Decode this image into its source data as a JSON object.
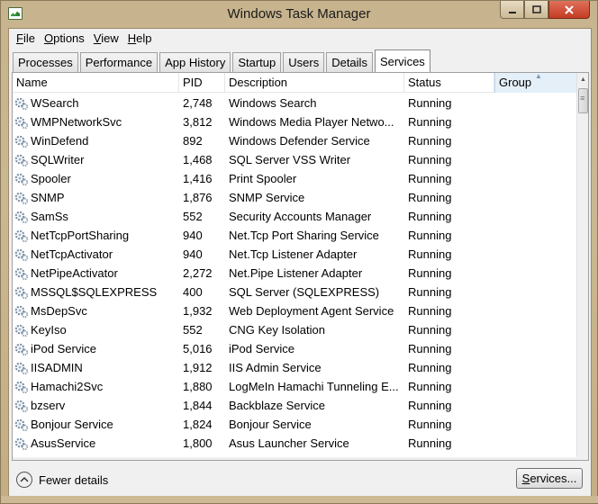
{
  "window": {
    "title": "Windows Task Manager"
  },
  "menu": [
    {
      "label": "File",
      "hotkey": "F",
      "rest": "ile"
    },
    {
      "label": "Options",
      "hotkey": "O",
      "rest": "ptions"
    },
    {
      "label": "View",
      "hotkey": "V",
      "rest": "iew"
    },
    {
      "label": "Help",
      "hotkey": "H",
      "rest": "elp"
    }
  ],
  "tabs": [
    {
      "label": "Processes"
    },
    {
      "label": "Performance"
    },
    {
      "label": "App History"
    },
    {
      "label": "Startup"
    },
    {
      "label": "Users"
    },
    {
      "label": "Details"
    },
    {
      "label": "Services",
      "active": true
    }
  ],
  "columns": {
    "name": "Name",
    "pid": "PID",
    "description": "Description",
    "status": "Status",
    "group": "Group"
  },
  "rows": [
    {
      "name": "WSearch",
      "pid": "2,748",
      "description": "Windows Search",
      "status": "Running",
      "group": ""
    },
    {
      "name": "WMPNetworkSvc",
      "pid": "3,812",
      "description": "Windows Media Player Netwo...",
      "status": "Running",
      "group": ""
    },
    {
      "name": "WinDefend",
      "pid": "892",
      "description": "Windows Defender Service",
      "status": "Running",
      "group": ""
    },
    {
      "name": "SQLWriter",
      "pid": "1,468",
      "description": "SQL Server VSS Writer",
      "status": "Running",
      "group": ""
    },
    {
      "name": "Spooler",
      "pid": "1,416",
      "description": "Print Spooler",
      "status": "Running",
      "group": ""
    },
    {
      "name": "SNMP",
      "pid": "1,876",
      "description": "SNMP Service",
      "status": "Running",
      "group": ""
    },
    {
      "name": "SamSs",
      "pid": "552",
      "description": "Security Accounts Manager",
      "status": "Running",
      "group": ""
    },
    {
      "name": "NetTcpPortSharing",
      "pid": "940",
      "description": "Net.Tcp Port Sharing Service",
      "status": "Running",
      "group": ""
    },
    {
      "name": "NetTcpActivator",
      "pid": "940",
      "description": "Net.Tcp Listener Adapter",
      "status": "Running",
      "group": ""
    },
    {
      "name": "NetPipeActivator",
      "pid": "2,272",
      "description": "Net.Pipe Listener Adapter",
      "status": "Running",
      "group": ""
    },
    {
      "name": "MSSQL$SQLEXPRESS",
      "pid": "400",
      "description": "SQL Server (SQLEXPRESS)",
      "status": "Running",
      "group": ""
    },
    {
      "name": "MsDepSvc",
      "pid": "1,932",
      "description": "Web Deployment Agent Service",
      "status": "Running",
      "group": ""
    },
    {
      "name": "KeyIso",
      "pid": "552",
      "description": "CNG Key Isolation",
      "status": "Running",
      "group": ""
    },
    {
      "name": "iPod Service",
      "pid": "5,016",
      "description": "iPod Service",
      "status": "Running",
      "group": ""
    },
    {
      "name": "IISADMIN",
      "pid": "1,912",
      "description": "IIS Admin Service",
      "status": "Running",
      "group": ""
    },
    {
      "name": "Hamachi2Svc",
      "pid": "1,880",
      "description": "LogMeIn Hamachi Tunneling E...",
      "status": "Running",
      "group": ""
    },
    {
      "name": "bzserv",
      "pid": "1,844",
      "description": "Backblaze Service",
      "status": "Running",
      "group": ""
    },
    {
      "name": "Bonjour Service",
      "pid": "1,824",
      "description": "Bonjour Service",
      "status": "Running",
      "group": ""
    },
    {
      "name": "AsusService",
      "pid": "1,800",
      "description": "Asus Launcher Service",
      "status": "Running",
      "group": ""
    }
  ],
  "footer": {
    "fewer_details": "Fewer details",
    "services_button": {
      "label": "Services...",
      "hotkey": "S",
      "rest": "ervices..."
    }
  },
  "icons": {
    "service": "gear-icon",
    "app": "task-manager-icon"
  }
}
